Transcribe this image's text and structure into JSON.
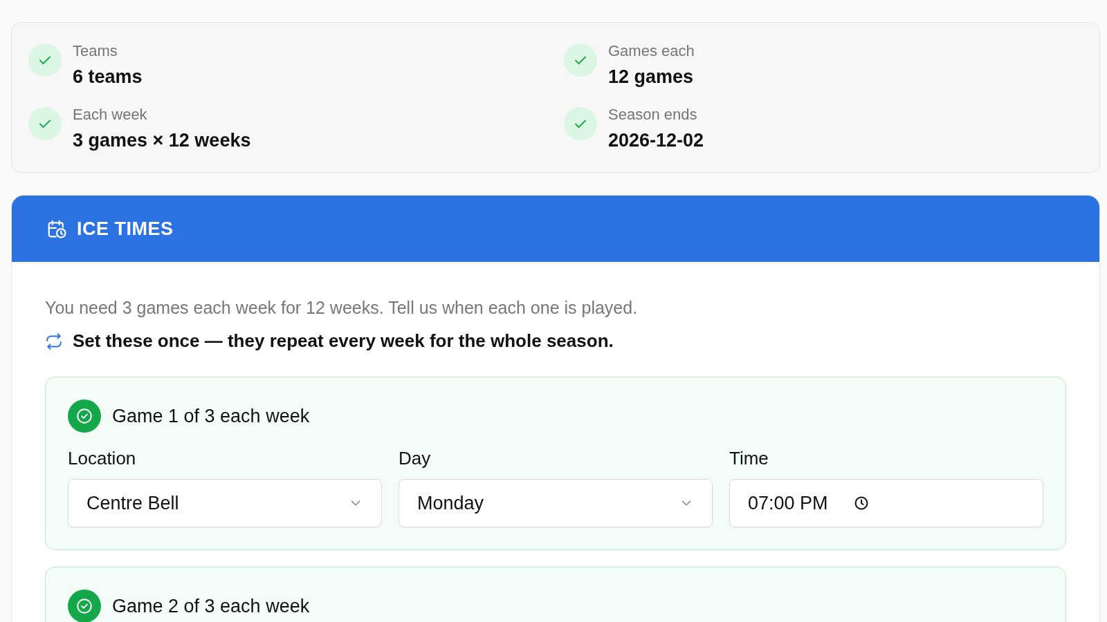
{
  "summary": [
    {
      "label": "Teams",
      "value": "6 teams",
      "checked": true
    },
    {
      "label": "Games each",
      "value": "12 games",
      "checked": true
    },
    {
      "label": "Each week",
      "value": "3 games × 12 weeks",
      "checked": true
    },
    {
      "label": "Season ends",
      "value": "2026-12-02",
      "checked": true
    }
  ],
  "panel": {
    "title": "ICE TIMES",
    "intro": "You need 3 games each week for 12 weeks. Tell us when each one is played.",
    "note": "Set these once — they repeat every week for the whole season.",
    "games": [
      {
        "title": "Game 1 of 3 each week",
        "complete": true,
        "fields": [
          {
            "label": "Location",
            "value": "Centre Bell",
            "kind": "select"
          },
          {
            "label": "Day",
            "value": "Monday",
            "kind": "select"
          },
          {
            "label": "Time",
            "value": "07:00 PM",
            "kind": "time"
          }
        ]
      },
      {
        "title": "Game 2 of 3 each week",
        "complete": true
      }
    ]
  }
}
